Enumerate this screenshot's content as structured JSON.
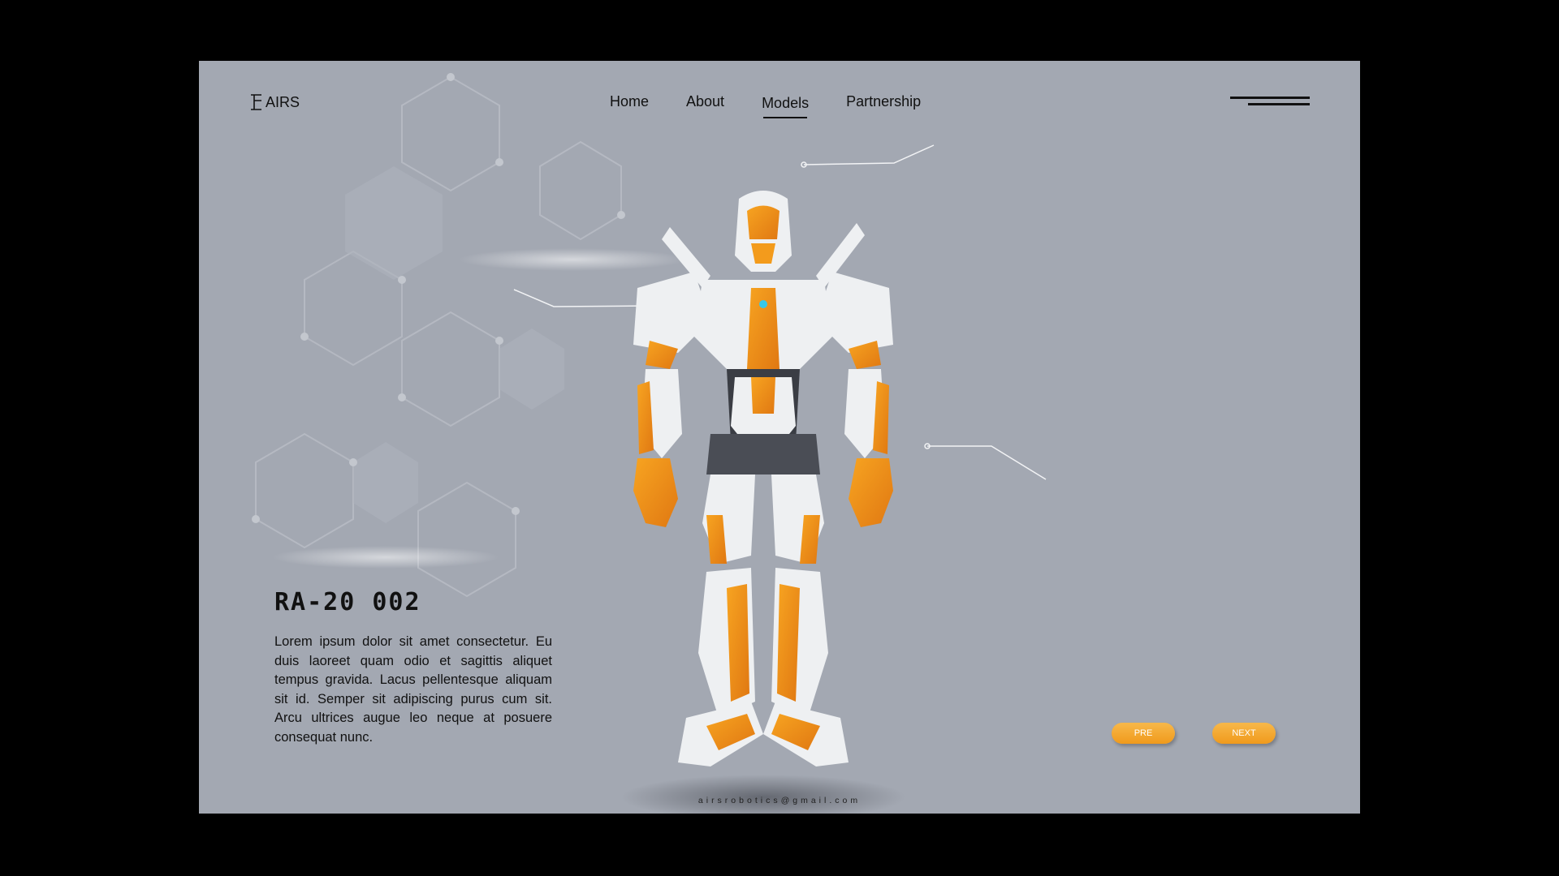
{
  "brand": {
    "logo_text": "AIRS"
  },
  "nav": {
    "items": [
      {
        "label": "Home",
        "active": false
      },
      {
        "label": "About",
        "active": false
      },
      {
        "label": "Models",
        "active": true
      },
      {
        "label": "Partnership",
        "active": false
      }
    ]
  },
  "hero": {
    "model_name": "RA-20 002",
    "description": "Lorem ipsum dolor sit amet consectetur. Eu duis laoreet quam odio et sagittis aliquet tempus gravida. Lacus pellentesque aliquam sit id. Semper sit adipiscing purus cum sit. Arcu ultrices augue leo neque at posuere consequat nunc."
  },
  "controls": {
    "prev_label": "PRE",
    "next_label": "NEXT"
  },
  "footer": {
    "email": "airsrobotics@gmail.com"
  },
  "colors": {
    "page_background": "#000000",
    "frame_background": "#a3a8b2",
    "accent_orange": "#f09a1c",
    "robot_white": "#eef0f2",
    "text": "#111111"
  },
  "icons": {
    "menu": "hamburger-menu-icon",
    "logo": "airs-logo-mark"
  }
}
